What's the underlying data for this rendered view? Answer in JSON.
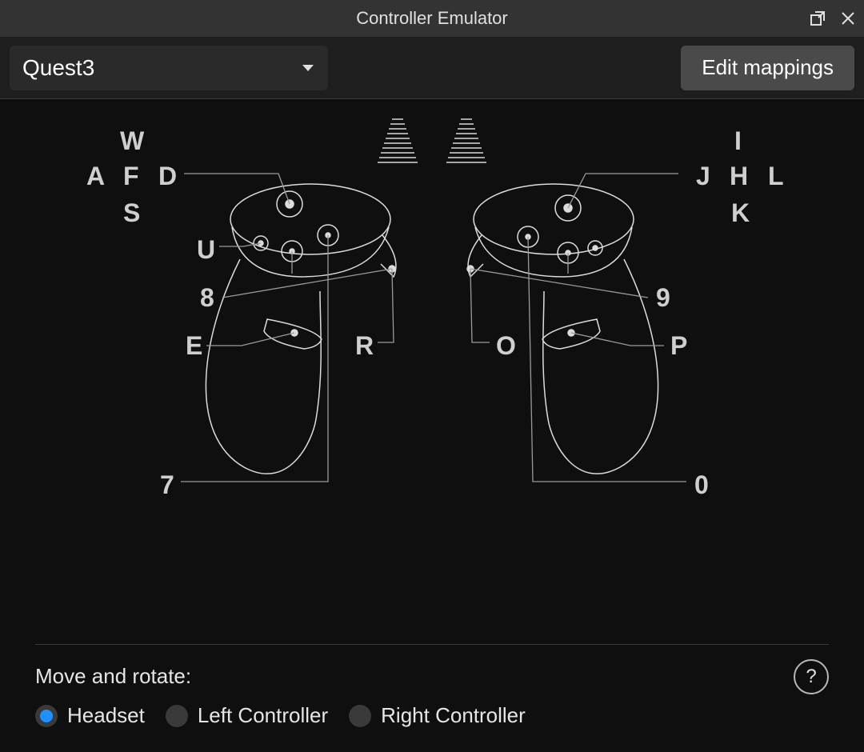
{
  "window": {
    "title": "Controller Emulator"
  },
  "toolbar": {
    "device_selected": "Quest3",
    "edit_button": "Edit mappings"
  },
  "keys": {
    "left": {
      "thumb_up": "W",
      "thumb_left": "A",
      "thumb_click": "F",
      "thumb_right": "D",
      "thumb_down": "S",
      "menu": "U",
      "trigger": "8",
      "grip": "E",
      "x": "7",
      "y": "R"
    },
    "right": {
      "thumb_up": "I",
      "thumb_left": "J",
      "thumb_click": "H",
      "thumb_right": "L",
      "thumb_down": "K",
      "trigger": "9",
      "grip": "P",
      "a": "0",
      "b": "O"
    }
  },
  "footer": {
    "label": "Move and rotate:",
    "options": {
      "headset": "Headset",
      "left": "Left Controller",
      "right": "Right Controller"
    },
    "selected": "headset",
    "help": "?"
  }
}
